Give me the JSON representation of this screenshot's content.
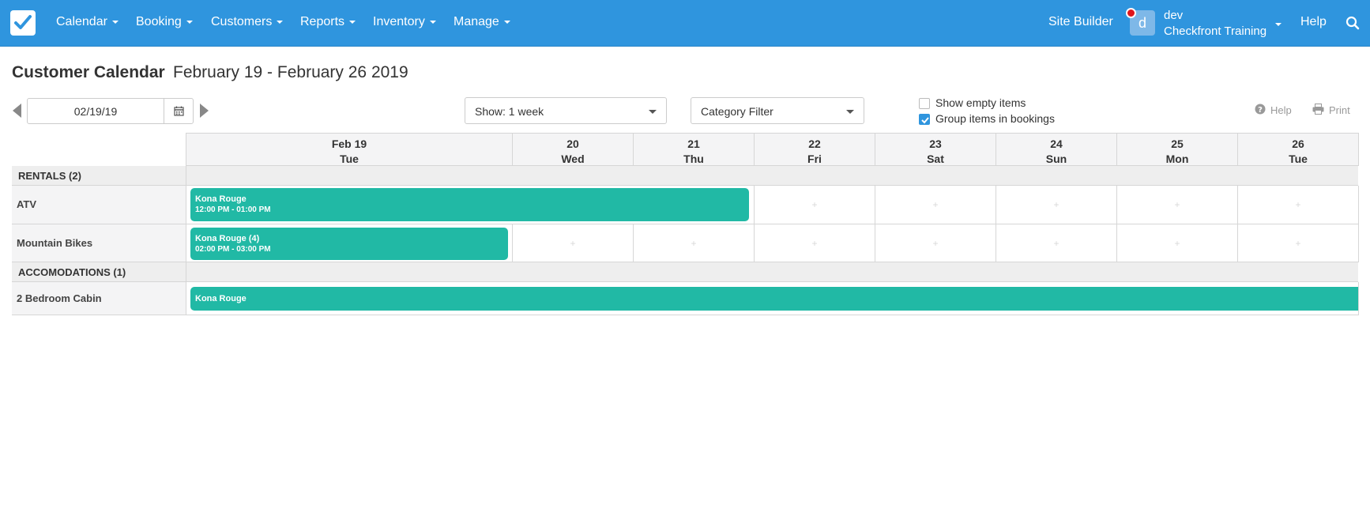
{
  "nav": {
    "items": [
      {
        "label": "Calendar"
      },
      {
        "label": "Booking"
      },
      {
        "label": "Customers"
      },
      {
        "label": "Reports"
      },
      {
        "label": "Inventory"
      },
      {
        "label": "Manage"
      }
    ],
    "site_builder": "Site Builder",
    "avatar_letter": "d",
    "user_name": "dev",
    "user_org": "Checkfront Training",
    "help": "Help"
  },
  "page": {
    "title": "Customer Calendar",
    "subtitle": "February 19 - February 26 2019"
  },
  "controls": {
    "date_value": "02/19/19",
    "show_select": "Show: 1 week",
    "category_select": "Category Filter",
    "show_empty_label": "Show empty items",
    "show_empty_checked": false,
    "group_items_label": "Group items in bookings",
    "group_items_checked": true,
    "help_label": "Help",
    "print_label": "Print"
  },
  "calendar": {
    "days": [
      {
        "date": "Feb 19",
        "dow": "Tue"
      },
      {
        "date": "20",
        "dow": "Wed"
      },
      {
        "date": "21",
        "dow": "Thu"
      },
      {
        "date": "22",
        "dow": "Fri"
      },
      {
        "date": "23",
        "dow": "Sat"
      },
      {
        "date": "24",
        "dow": "Sun"
      },
      {
        "date": "25",
        "dow": "Mon"
      },
      {
        "date": "26",
        "dow": "Tue"
      }
    ],
    "groups": [
      {
        "label": "RENTALS (2)"
      },
      {
        "label": "ACCOMODATIONS (1)"
      }
    ],
    "items": [
      {
        "label": "ATV"
      },
      {
        "label": "Mountain Bikes"
      },
      {
        "label": "2 Bedroom Cabin"
      }
    ],
    "bookings": [
      {
        "name": "Kona Rouge",
        "time": "12:00 PM - 01:00 PM"
      },
      {
        "name": "Kona Rouge (4)",
        "time": "02:00 PM - 03:00 PM"
      },
      {
        "name": "Kona Rouge",
        "time": ""
      }
    ],
    "colors": {
      "booking": "#21b9a5",
      "navbar": "#2f95de"
    }
  }
}
